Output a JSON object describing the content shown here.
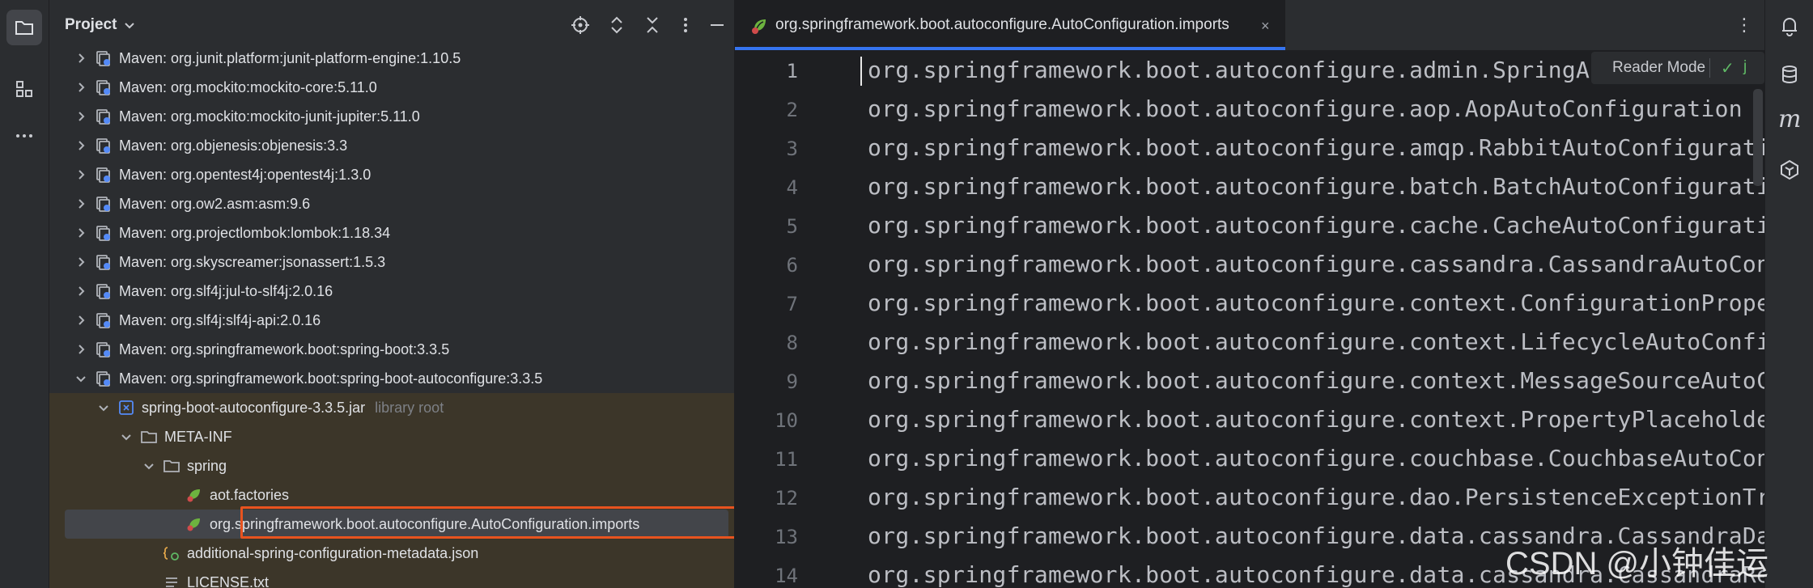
{
  "project_panel": {
    "title": "Project",
    "tree": [
      {
        "indent": 1,
        "arrow": "right",
        "icon": "maven-library-icon",
        "label": "Maven: org.junit.platform:junit-platform-engine:1.10.5"
      },
      {
        "indent": 1,
        "arrow": "right",
        "icon": "maven-library-icon",
        "label": "Maven: org.mockito:mockito-core:5.11.0"
      },
      {
        "indent": 1,
        "arrow": "right",
        "icon": "maven-library-icon",
        "label": "Maven: org.mockito:mockito-junit-jupiter:5.11.0"
      },
      {
        "indent": 1,
        "arrow": "right",
        "icon": "maven-library-icon",
        "label": "Maven: org.objenesis:objenesis:3.3"
      },
      {
        "indent": 1,
        "arrow": "right",
        "icon": "maven-library-icon",
        "label": "Maven: org.opentest4j:opentest4j:1.3.0"
      },
      {
        "indent": 1,
        "arrow": "right",
        "icon": "maven-library-icon",
        "label": "Maven: org.ow2.asm:asm:9.6"
      },
      {
        "indent": 1,
        "arrow": "right",
        "icon": "maven-library-icon",
        "label": "Maven: org.projectlombok:lombok:1.18.34"
      },
      {
        "indent": 1,
        "arrow": "right",
        "icon": "maven-library-icon",
        "label": "Maven: org.skyscreamer:jsonassert:1.5.3"
      },
      {
        "indent": 1,
        "arrow": "right",
        "icon": "maven-library-icon",
        "label": "Maven: org.slf4j:jul-to-slf4j:2.0.16"
      },
      {
        "indent": 1,
        "arrow": "right",
        "icon": "maven-library-icon",
        "label": "Maven: org.slf4j:slf4j-api:2.0.16"
      },
      {
        "indent": 1,
        "arrow": "right",
        "icon": "maven-library-icon",
        "label": "Maven: org.springframework.boot:spring-boot:3.3.5"
      },
      {
        "indent": 1,
        "arrow": "down",
        "icon": "maven-library-icon",
        "label": "Maven: org.springframework.boot:spring-boot-autoconfigure:3.3.5"
      },
      {
        "indent": 2,
        "arrow": "down",
        "icon": "jar-icon",
        "label": "spring-boot-autoconfigure-3.3.5.jar",
        "suffix": "library root",
        "inlib": true
      },
      {
        "indent": 3,
        "arrow": "down",
        "icon": "folder-icon",
        "label": "META-INF",
        "inlib": true
      },
      {
        "indent": 4,
        "arrow": "down",
        "icon": "folder-icon",
        "label": "spring",
        "inlib": true
      },
      {
        "indent": 5,
        "arrow": "",
        "icon": "spring-file-icon",
        "label": "aot.factories",
        "inlib": true
      },
      {
        "indent": 5,
        "arrow": "",
        "icon": "spring-file-icon",
        "label": "org.springframework.boot.autoconfigure.AutoConfiguration.imports",
        "inlib": true,
        "selected": true
      },
      {
        "indent": 4,
        "arrow": "",
        "icon": "json-file-icon",
        "label": "additional-spring-configuration-metadata.json",
        "inlib": true
      },
      {
        "indent": 4,
        "arrow": "",
        "icon": "text-file-icon",
        "label": "LICENSE.txt",
        "inlib": true
      }
    ]
  },
  "editor": {
    "tab_label": "org.springframework.boot.autoconfigure.AutoConfiguration.imports",
    "tab_close": "×",
    "reader_mode": "Reader Mode",
    "reader_check": "✓",
    "reader_extra": "j",
    "lines": [
      {
        "n": "1",
        "text": "org.springframework.boot.autoconfigure.admin.SpringAp"
      },
      {
        "n": "2",
        "text": "org.springframework.boot.autoconfigure.aop.AopAutoConfiguration"
      },
      {
        "n": "3",
        "text": "org.springframework.boot.autoconfigure.amqp.RabbitAutoConfiguratio"
      },
      {
        "n": "4",
        "text": "org.springframework.boot.autoconfigure.batch.BatchAutoConfiguratio"
      },
      {
        "n": "5",
        "text": "org.springframework.boot.autoconfigure.cache.CacheAutoConfiguratio"
      },
      {
        "n": "6",
        "text": "org.springframework.boot.autoconfigure.cassandra.CassandraAutoConf"
      },
      {
        "n": "7",
        "text": "org.springframework.boot.autoconfigure.context.ConfigurationProper"
      },
      {
        "n": "8",
        "text": "org.springframework.boot.autoconfigure.context.LifecycleAutoConfig"
      },
      {
        "n": "9",
        "text": "org.springframework.boot.autoconfigure.context.MessageSourceAutoCo"
      },
      {
        "n": "10",
        "text": "org.springframework.boot.autoconfigure.context.PropertyPlaceholder"
      },
      {
        "n": "11",
        "text": "org.springframework.boot.autoconfigure.couchbase.CouchbaseAutoConf"
      },
      {
        "n": "12",
        "text": "org.springframework.boot.autoconfigure.dao.PersistenceExceptionTra"
      },
      {
        "n": "13",
        "text": "org.springframework.boot.autoconfigure.data.cassandra.CassandraDat"
      },
      {
        "n": "14",
        "text": "org.springframework.boot.autoconfigure.data.cassandra.CassandraRea"
      }
    ]
  },
  "watermark": "CSDN @小钟佳运",
  "colors": {
    "accent": "#3574f0",
    "highlight": "#e8531f",
    "library_bg": "#3c3629"
  }
}
